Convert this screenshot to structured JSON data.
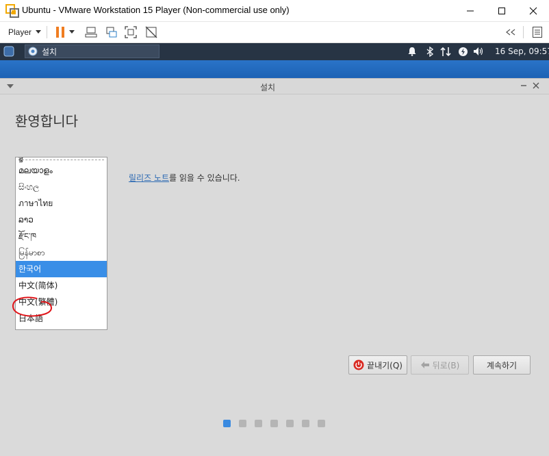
{
  "window": {
    "title": "Ubuntu - VMware Workstation 15 Player (Non-commercial use only)",
    "controls": [
      "minimize-icon",
      "maximize-icon",
      "close-icon"
    ]
  },
  "toolbar": {
    "player_label": "Player",
    "icons": [
      "pause-icon",
      "send-ctrl-alt-del-icon",
      "removable-devices-icon",
      "fullscreen-icon",
      "unity-icon",
      "collapse-toolbar-icon",
      "library-icon"
    ],
    "pause_color": "#f07d21"
  },
  "panel": {
    "taskbar_item_label": "설치",
    "clock": "16 Sep, 09:57",
    "tray_icons": [
      "notification-bell-icon",
      "bluetooth-icon",
      "network-icon",
      "power-icon",
      "volume-icon"
    ]
  },
  "installer": {
    "window_title": "설치",
    "heading": "환영합니다",
    "languages": [
      {
        "label": "മലയാളം",
        "selected": false
      },
      {
        "label": "සිංහල",
        "selected": false
      },
      {
        "label": "ภาษาไทย",
        "selected": false
      },
      {
        "label": "ລາວ",
        "selected": false
      },
      {
        "label": "རྫོང་ཁ",
        "selected": false
      },
      {
        "label": "မြန်မာစာ",
        "selected": false
      },
      {
        "label": "한국어",
        "selected": true
      },
      {
        "label": "中文(简体)",
        "selected": false
      },
      {
        "label": "中文(繁體)",
        "selected": false
      },
      {
        "label": "日本語",
        "selected": false
      }
    ],
    "partial_top_item": "ॿ",
    "release_notes_link": "릴리즈 노트",
    "release_notes_text": "를 읽을 수 있습니다.",
    "buttons": {
      "quit": "끝내기(Q)",
      "back": "뒤로(B)",
      "next": "계속하기"
    },
    "progress": {
      "total_steps": 7,
      "current_step": 1
    },
    "accent_color": "#398ee7"
  }
}
